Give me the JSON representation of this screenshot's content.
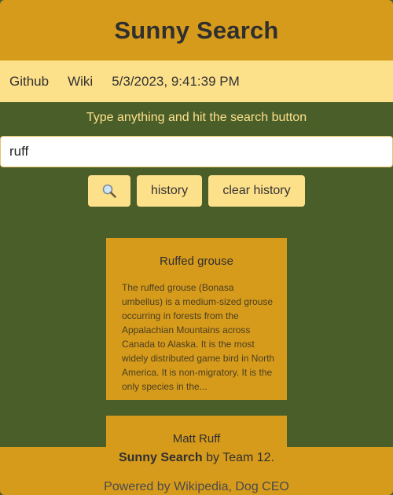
{
  "header": {
    "title": "Sunny Search"
  },
  "nav": {
    "github": "Github",
    "wiki": "Wiki",
    "clock": "5/3/2023, 9:41:39 PM"
  },
  "search": {
    "hint": "Type anything and hit the search button",
    "value": "ruff",
    "history_label": "history",
    "clear_label": "clear history"
  },
  "results": [
    {
      "title": "Ruffed grouse",
      "snippet": "The ruffed grouse (Bonasa umbellus) is a medium-sized grouse occurring in forests from the Appalachian Mountains across Canada to Alaska. It is the most widely distributed game bird in North America. It is non-migratory. It is the only species in the..."
    },
    {
      "title": "Matt Ruff"
    }
  ],
  "footer": {
    "brand": "Sunny Search",
    "by": " by ",
    "team": "Team 12",
    "period": ".",
    "powered": "Powered by Wikipedia, Dog CEO"
  },
  "colors": {
    "background": "#4a5e2a",
    "header": "#d79b1c",
    "nav": "#fde08a",
    "card": "#d79b1c"
  },
  "icons": {
    "search_button": "magnifier-icon"
  }
}
